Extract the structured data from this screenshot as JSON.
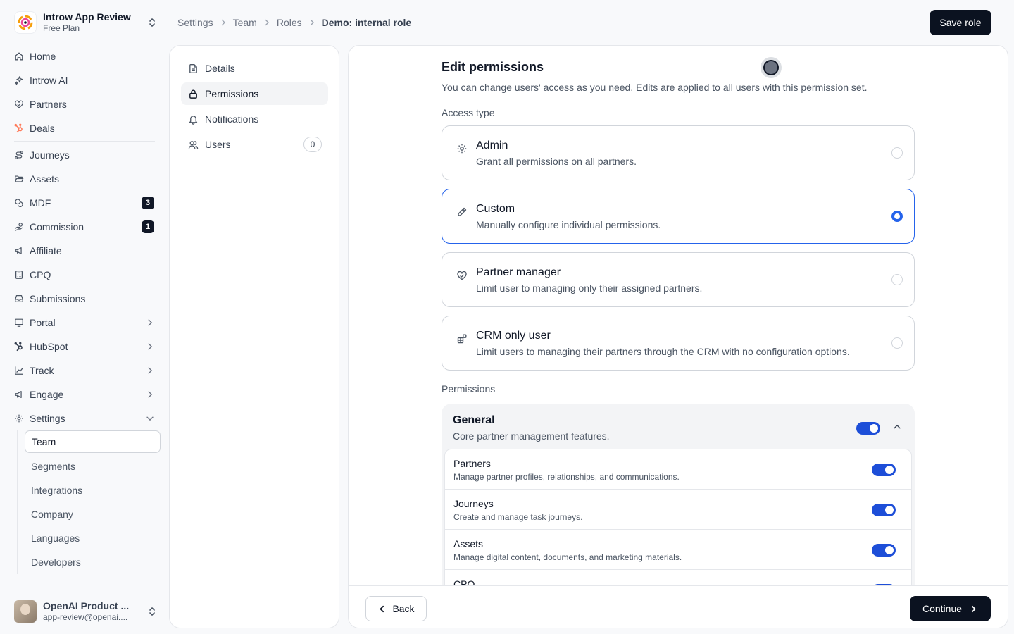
{
  "org": {
    "name": "Introw App Review",
    "plan": "Free Plan"
  },
  "nav": {
    "home": "Home",
    "ai": "Introw AI",
    "partners": "Partners",
    "deals": "Deals",
    "journeys": "Journeys",
    "assets": "Assets",
    "mdf": "MDF",
    "mdf_count": "3",
    "commission": "Commission",
    "commission_count": "1",
    "affiliate": "Affiliate",
    "cpq": "CPQ",
    "submissions": "Submissions",
    "portal": "Portal",
    "hubspot": "HubSpot",
    "track": "Track",
    "engage": "Engage",
    "settings": "Settings",
    "settings_sub": [
      "Team",
      "Segments",
      "Integrations",
      "Company",
      "Languages",
      "Developers"
    ]
  },
  "user": {
    "name": "OpenAI Product ...",
    "email": "app-review@openai...."
  },
  "breadcrumb": [
    "Settings",
    "Team",
    "Roles",
    "Demo: internal role"
  ],
  "header": {
    "save_label": "Save role"
  },
  "subnav": {
    "details": "Details",
    "permissions": "Permissions",
    "notifications": "Notifications",
    "users": "Users",
    "users_count": "0"
  },
  "main": {
    "title": "Edit permissions",
    "description": "You can change users' access as you need. Edits are applied to all users with this permission set.",
    "access_label": "Access type",
    "access_options": [
      {
        "title": "Admin",
        "desc": "Grant all permissions on all partners."
      },
      {
        "title": "Custom",
        "desc": "Manually configure individual permissions."
      },
      {
        "title": "Partner manager",
        "desc": "Limit user to managing only their assigned partners."
      },
      {
        "title": "CRM only user",
        "desc": "Limit users to managing their partners through the CRM with no configuration options."
      }
    ],
    "selected_access": "Custom",
    "permissions_label": "Permissions",
    "general": {
      "title": "General",
      "desc": "Core partner management features.",
      "rows": [
        {
          "title": "Partners",
          "desc": "Manage partner profiles, relationships, and communications."
        },
        {
          "title": "Journeys",
          "desc": "Create and manage task journeys."
        },
        {
          "title": "Assets",
          "desc": "Manage digital content, documents, and marketing materials."
        },
        {
          "title": "CPQ",
          "desc": ""
        }
      ]
    }
  },
  "footer": {
    "back_label": "Back",
    "continue_label": "Continue"
  },
  "colors": {
    "accent": "#2563eb",
    "toggle": "#1d4ed8",
    "primary_button": "#0b1220",
    "hubspot": "#ff7a59"
  }
}
